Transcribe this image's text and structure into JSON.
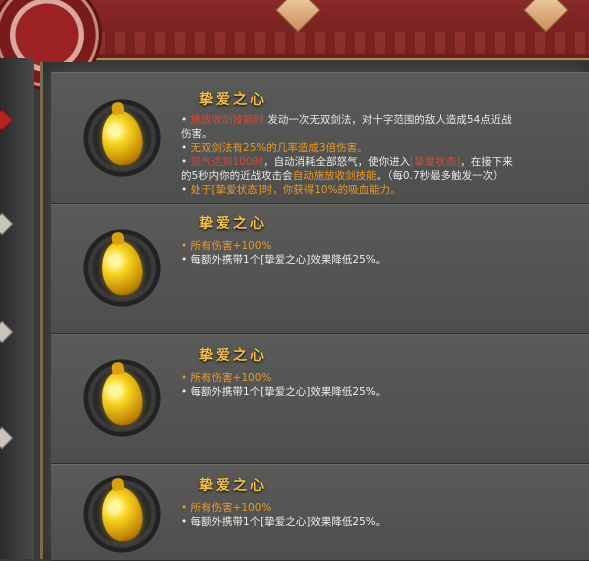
{
  "cards": [
    {
      "title": "挚爱之心",
      "lines": [
        {
          "bullet": "•",
          "a": "施放收剑技能时",
          "b": " 发动一次无双剑法，对十字范围的敌人造成54点近战"
        },
        {
          "cont": "伤害。"
        },
        {
          "bullet": "•",
          "orange": "无双剑法有25%的几率造成3倍伤害。"
        },
        {
          "bullet": "•",
          "a": "怒气达到100时",
          "b": "，自动消耗全部怒气，使你进入",
          "c": "[挚爱状态]",
          "d": "，在接下来"
        },
        {
          "cont": "的5秒内你的近战攻击会",
          "orange": "自动施放收剑技能",
          "e": "。（每0.7秒最多触发一次）"
        },
        {
          "bullet": "•",
          "orange": "处于[挚爱状态]时，你获得10%的吸血能力。"
        }
      ]
    },
    {
      "title": "挚爱之心",
      "line1": "• 所有伤害+100%",
      "line2": "• 每额外携带1个[挚爱之心]效果降低25%。"
    },
    {
      "title": "挚爱之心",
      "line1": "• 所有伤害+100%",
      "line2": "• 每额外携带1个[挚爱之心]效果降低25%。"
    },
    {
      "title": "挚爱之心",
      "line1": "• 所有伤害+100%",
      "line2": "• 每额外携带1个[挚爱之心]效果降低25%。"
    }
  ],
  "colors": {
    "title": "#f0c04a",
    "highlight_orange": "#e8982a",
    "highlight_red": "#d24a3a"
  },
  "icons": [
    "golden-heart-icon"
  ]
}
